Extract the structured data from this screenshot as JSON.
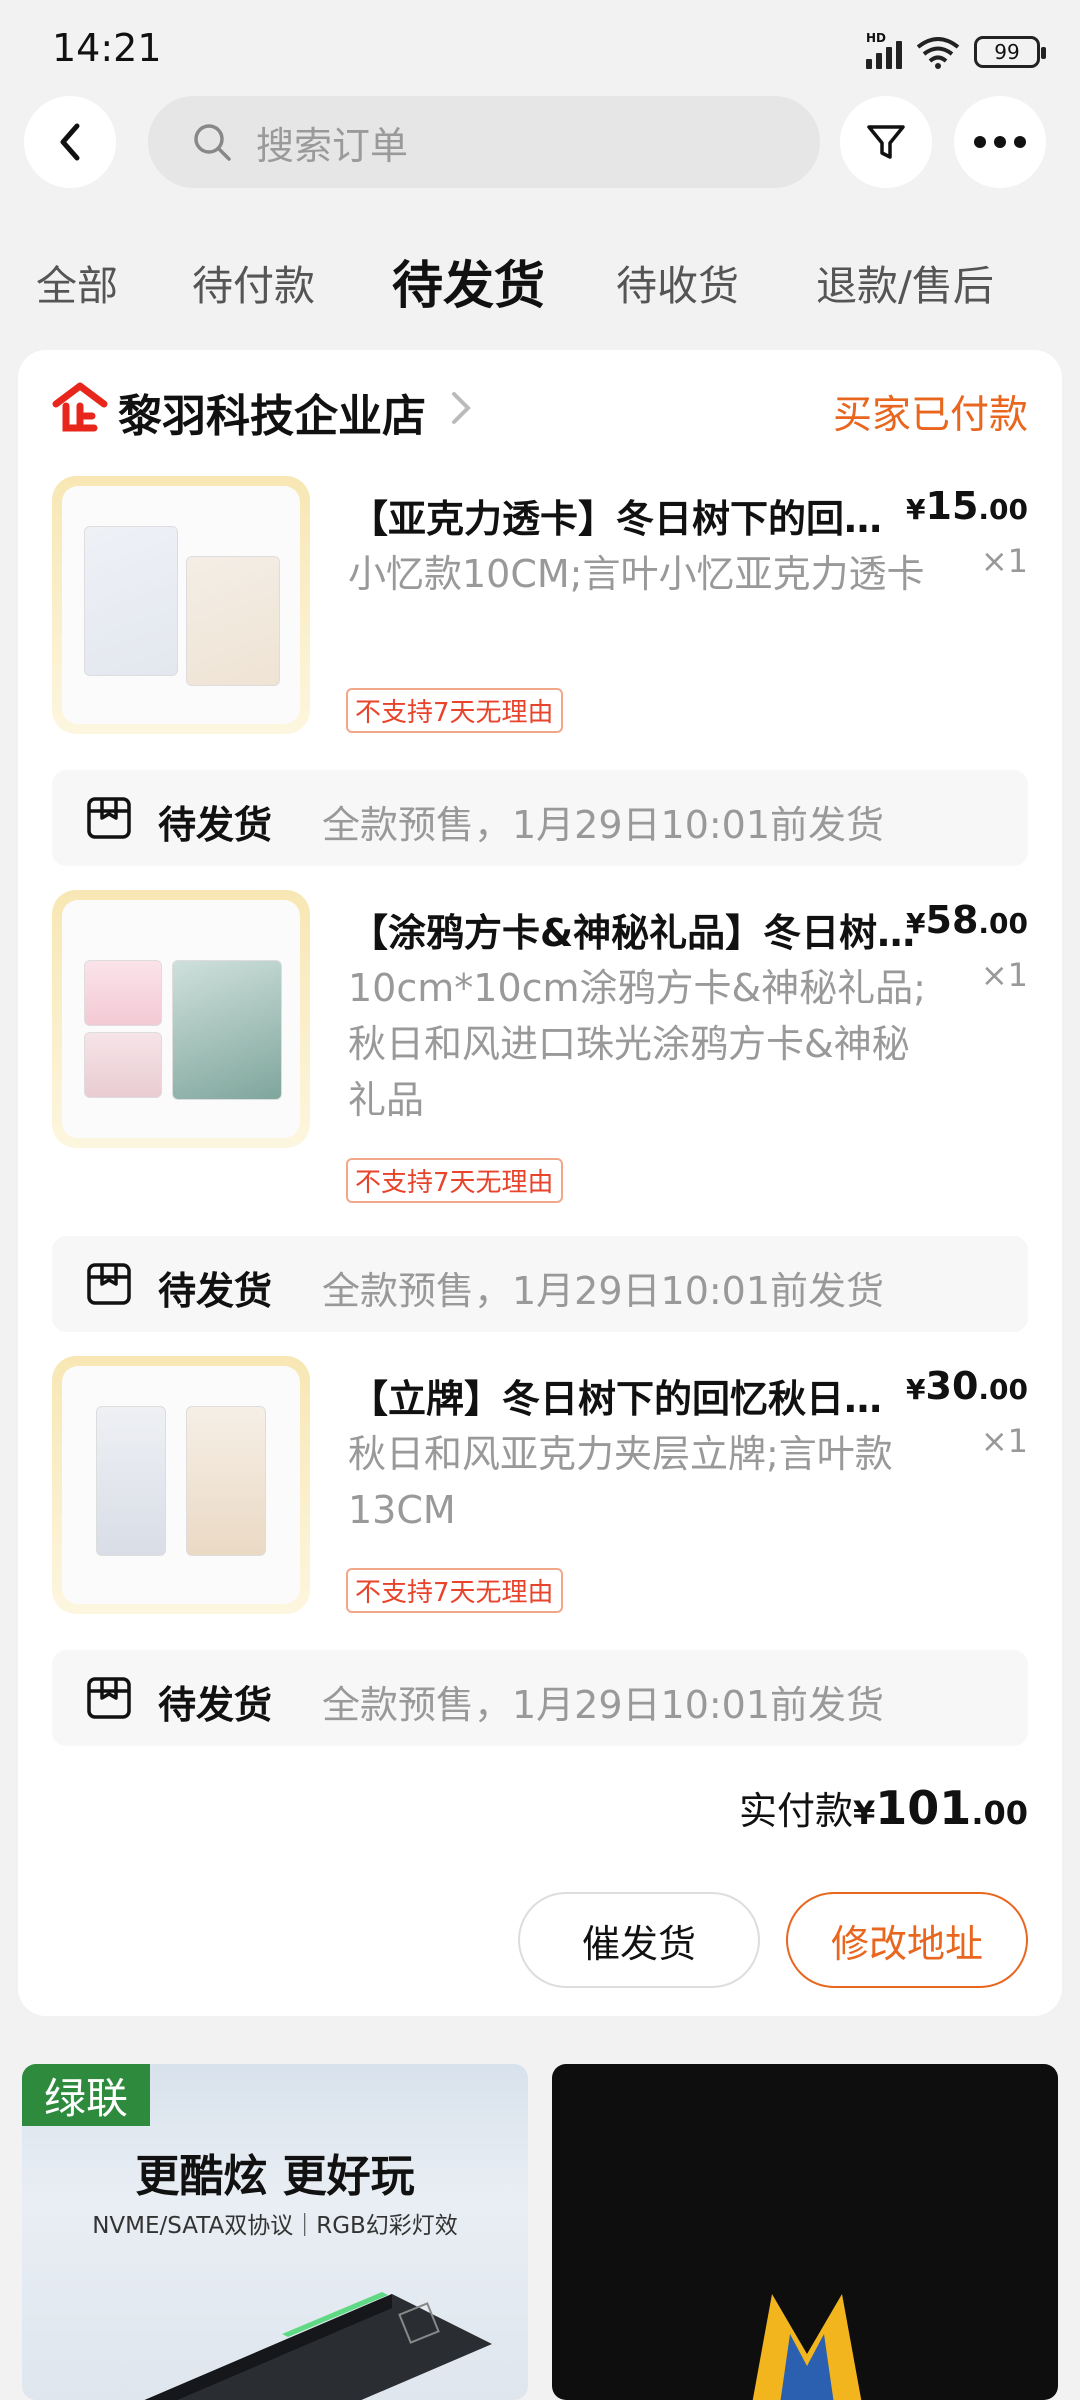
{
  "status_bar": {
    "time": "14:21",
    "network_label": "HD",
    "battery_level": "99",
    "icons": [
      "hd-signal-icon",
      "wifi-icon",
      "battery-icon"
    ]
  },
  "top_bar": {
    "back_icon": "chevron-left-icon",
    "search_placeholder": "搜索订单",
    "filter_icon": "filter-icon",
    "more_icon": "more-dots-icon"
  },
  "tabs": [
    {
      "label": "全部",
      "active": false
    },
    {
      "label": "待付款",
      "active": false
    },
    {
      "label": "待发货",
      "active": true
    },
    {
      "label": "待收货",
      "active": false
    },
    {
      "label": "退款/售后",
      "active": false
    }
  ],
  "order": {
    "shop_name": "黎羽科技企业店",
    "status": "买家已付款",
    "items": [
      {
        "title": "【亚克力透卡】冬日树下的回忆言叶小忆亚克力透卡",
        "spec": "小忆款10CM;言叶小忆亚克力透卡",
        "price_symbol": "¥",
        "price_int": "15",
        "price_dec": ".00",
        "qty": "×1",
        "tag": "不支持7天无理由",
        "ship_label": "待发货",
        "ship_note": "全款预售，1月29日10:01前发货"
      },
      {
        "title": "【涂鸦方卡&神秘礼品】冬日树下的回忆",
        "spec": "10cm*10cm涂鸦方卡&神秘礼品;秋日和风进口珠光涂鸦方卡&神秘礼品",
        "price_symbol": "¥",
        "price_int": "58",
        "price_dec": ".00",
        "qty": "×1",
        "tag": "不支持7天无理由",
        "ship_label": "待发货",
        "ship_note": "全款预售，1月29日10:01前发货"
      },
      {
        "title": "【立牌】冬日树下的回忆秋日和风亚克力立牌",
        "spec": "秋日和风亚克力夹层立牌;言叶款13CM",
        "price_symbol": "¥",
        "price_int": "30",
        "price_dec": ".00",
        "qty": "×1",
        "tag": "不支持7天无理由",
        "ship_label": "待发货",
        "ship_note": "全款预售，1月29日10:01前发货"
      }
    ],
    "total_label": "实付款",
    "total_symbol": "¥",
    "total_int": "101",
    "total_dec": ".00",
    "buttons": {
      "urge": "催发货",
      "change_address": "修改地址"
    }
  },
  "recommendations": {
    "left": {
      "brand": "绿联",
      "headline": "更酷炫 更好玩",
      "subline": "NVME/SATA双协议｜RGB幻彩灯效"
    }
  },
  "colors": {
    "accent_orange": "#e8661e",
    "tag_red": "#e8432b",
    "brand_green": "#2e8b3e",
    "background": "#f2f2f2"
  }
}
